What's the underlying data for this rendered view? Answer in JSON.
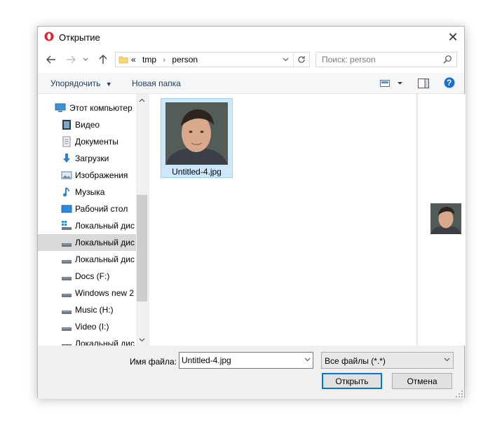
{
  "window": {
    "title": "Открытие",
    "close_glyph": "✕"
  },
  "nav": {
    "back_icon": "arrow-left-icon",
    "forward_icon": "arrow-right-icon",
    "recent_icon": "chevron-down-icon",
    "up_icon": "arrow-up-icon",
    "path_prefix": "«",
    "path": [
      "tmp",
      "person"
    ],
    "refresh_icon": "refresh-icon",
    "search_placeholder": "Поиск: person"
  },
  "toolbar": {
    "organize_label": "Упорядочить",
    "new_folder_label": "Новая папка",
    "view_icon": "view-options-icon",
    "preview_pane_icon": "preview-pane-icon",
    "help_label": "?"
  },
  "sidebar": {
    "items": [
      {
        "label": "Этот компьютер",
        "icon": "computer-icon"
      },
      {
        "label": "Видео",
        "icon": "video-folder-icon"
      },
      {
        "label": "Документы",
        "icon": "documents-folder-icon"
      },
      {
        "label": "Загрузки",
        "icon": "downloads-folder-icon"
      },
      {
        "label": "Изображения",
        "icon": "pictures-folder-icon"
      },
      {
        "label": "Музыка",
        "icon": "music-folder-icon"
      },
      {
        "label": "Рабочий стол",
        "icon": "desktop-folder-icon"
      },
      {
        "label": "Локальный дис",
        "icon": "system-drive-icon"
      },
      {
        "label": "Локальный дис",
        "icon": "drive-icon"
      },
      {
        "label": "Локальный дис",
        "icon": "drive-icon"
      },
      {
        "label": "Docs (F:)",
        "icon": "drive-icon"
      },
      {
        "label": "Windows new 2",
        "icon": "drive-icon"
      },
      {
        "label": "Music (H:)",
        "icon": "drive-icon"
      },
      {
        "label": "Video (I:)",
        "icon": "drive-icon"
      },
      {
        "label": "Локальный дис",
        "icon": "drive-icon"
      }
    ],
    "selected_index": 8
  },
  "files": [
    {
      "name": "Untitled-4.jpg",
      "selected": true
    }
  ],
  "footer": {
    "filename_label": "Имя файла:",
    "filename_value": "Untitled-4.jpg",
    "filetype_value": "Все файлы (*.*)",
    "open_label": "Открыть",
    "cancel_label": "Отмена"
  },
  "colors": {
    "accent": "#0078d7",
    "selection_bg": "#cce8ff",
    "selection_border": "#99d1ff",
    "help_blue": "#1a6fd1",
    "opera_red": "#e0212f"
  }
}
